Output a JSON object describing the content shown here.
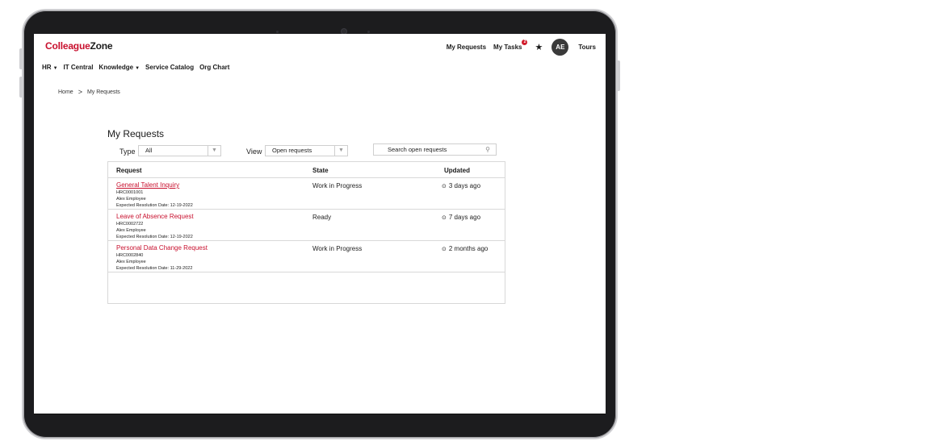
{
  "app": {
    "logo_part1": "Colleague",
    "logo_part2": "Zone"
  },
  "top_nav": {
    "my_requests": "My Requests",
    "my_tasks": "My Tasks",
    "tasks_badge": "2",
    "star_icon": "star-icon",
    "avatar_initials": "AE",
    "tours": "Tours"
  },
  "main_nav": [
    {
      "label": "HR",
      "has_caret": true
    },
    {
      "label": "IT Central",
      "has_caret": false
    },
    {
      "label": "Knowledge",
      "has_caret": true
    },
    {
      "label": "Service Catalog",
      "has_caret": false
    },
    {
      "label": "Org Chart",
      "has_caret": false
    }
  ],
  "breadcrumb": {
    "home": "Home",
    "separator": ">",
    "current": "My Requests"
  },
  "page": {
    "title": "My Requests",
    "type_label": "Type",
    "type_value": "All",
    "view_label": "View",
    "view_value": "Open requests",
    "search_placeholder": "Search open requests"
  },
  "table": {
    "headers": {
      "request": "Request",
      "state": "State",
      "updated": "Updated"
    },
    "rows": [
      {
        "title": "General Talent Inquiry",
        "number": "HRC0001001",
        "requester": "Alex Employee",
        "resolution": "Expected Resolution Date: 12-19-2022",
        "state": "Work in Progress",
        "updated": "3 days ago"
      },
      {
        "title": "Leave of Absence Request",
        "number": "HRC0002722",
        "requester": "Alex Employee",
        "resolution": "Expected Resolution Date: 12-19-2022",
        "state": "Ready",
        "updated": "7 days ago"
      },
      {
        "title": "Personal Data Change Request",
        "number": "HRC0002840",
        "requester": "Alex Employee",
        "resolution": "Expected Resolution Date: 11-29-2022",
        "state": "Work in Progress",
        "updated": "2 months ago"
      }
    ]
  },
  "colors": {
    "brand_red": "#c8102e",
    "badge_red": "#d11a2a",
    "avatar_bg": "#3a3a3a",
    "bezel": "#1c1c1e"
  }
}
